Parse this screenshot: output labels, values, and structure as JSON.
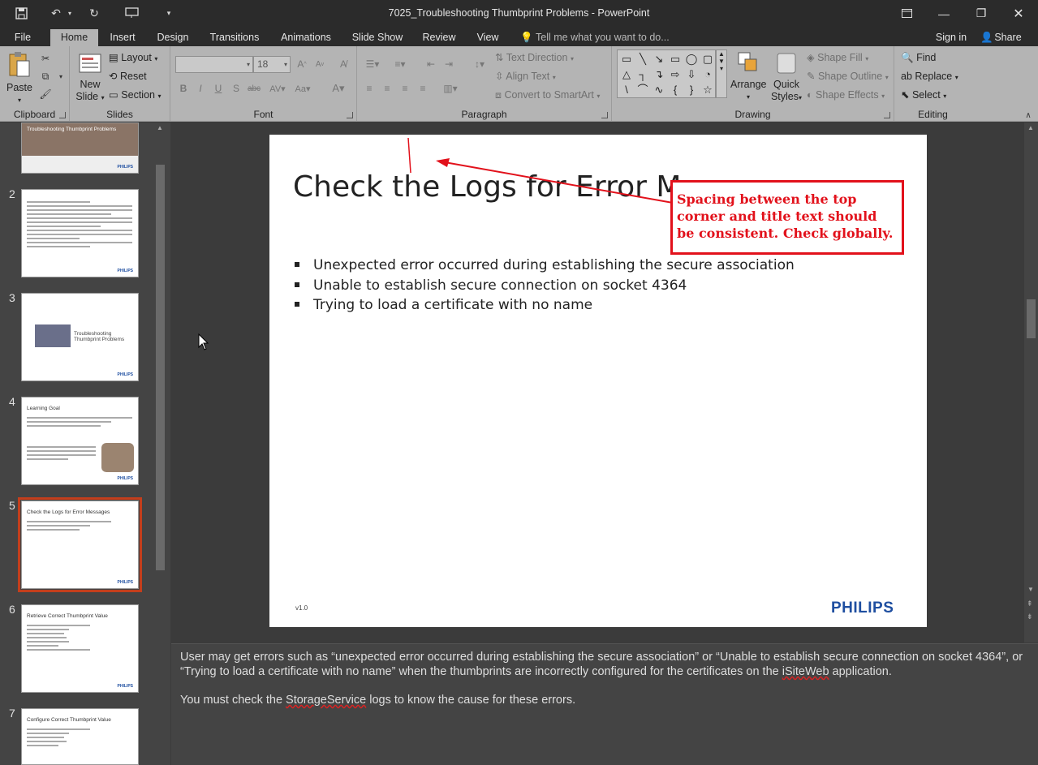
{
  "window": {
    "title": "7025_Troubleshooting Thumbprint Problems - PowerPoint"
  },
  "menu": {
    "file": "File",
    "tabs": [
      "Home",
      "Insert",
      "Design",
      "Transitions",
      "Animations",
      "Slide Show",
      "Review",
      "View"
    ],
    "active_tab": "Home",
    "tell_me": "Tell me what you want to do...",
    "sign_in": "Sign in",
    "share": "Share"
  },
  "ribbon": {
    "clipboard": {
      "label": "Clipboard",
      "paste": "Paste"
    },
    "slides": {
      "label": "Slides",
      "new_slide_1": "New",
      "new_slide_2": "Slide",
      "layout": "Layout",
      "reset": "Reset",
      "section": "Section"
    },
    "font": {
      "label": "Font",
      "font_name": "",
      "font_size": "18"
    },
    "paragraph": {
      "label": "Paragraph",
      "text_direction": "Text Direction",
      "align_text": "Align Text",
      "convert_smartart": "Convert to SmartArt"
    },
    "drawing": {
      "label": "Drawing",
      "arrange": "Arrange",
      "quick_styles_1": "Quick",
      "quick_styles_2": "Styles",
      "shape_fill": "Shape Fill",
      "shape_outline": "Shape Outline",
      "shape_effects": "Shape Effects"
    },
    "editing": {
      "label": "Editing",
      "find": "Find",
      "replace": "Replace",
      "select": "Select"
    }
  },
  "thumbnails": [
    {
      "num": "",
      "title": "Troubleshooting Thumbprint Problems"
    },
    {
      "num": "2",
      "title": ""
    },
    {
      "num": "3",
      "title": "Troubleshooting Thumbprint Problems"
    },
    {
      "num": "4",
      "title": "Learning Goal"
    },
    {
      "num": "5",
      "title": "Check the Logs for Error Messages"
    },
    {
      "num": "6",
      "title": "Retrieve Correct Thumbprint Value"
    },
    {
      "num": "7",
      "title": "Configure Correct Thumbprint Value"
    }
  ],
  "thumb_brand": "PHILIPS",
  "slide": {
    "title": "Check the Logs for Error Mes",
    "bullets": [
      "Unexpected error occurred during establishing the secure association",
      "Unable to establish secure connection on socket 4364",
      "Trying to load a certificate with no name"
    ],
    "version": "v1.0",
    "brand": "PHILIPS"
  },
  "callout": {
    "text": "Spacing between the top corner and title text should be consistent. Check globally.",
    "color": "#e2111b"
  },
  "notes": {
    "p1_a": "User may get errors such as “unexpected error occurred during establishing the secure association” or “Unable to establish secure connection on socket 4364”, or “Trying to load a certificate with no name” when the thumbprints are incorrectly configured for the certificates on the ",
    "p1_link": "iSiteWeb",
    "p1_b": " application.",
    "p2_a": "You must check the ",
    "p2_link": "StorageService",
    "p2_b": " logs to know the cause for these errors."
  },
  "colors": {
    "selection": "#c43e1c",
    "brand": "#1e4ea0"
  }
}
